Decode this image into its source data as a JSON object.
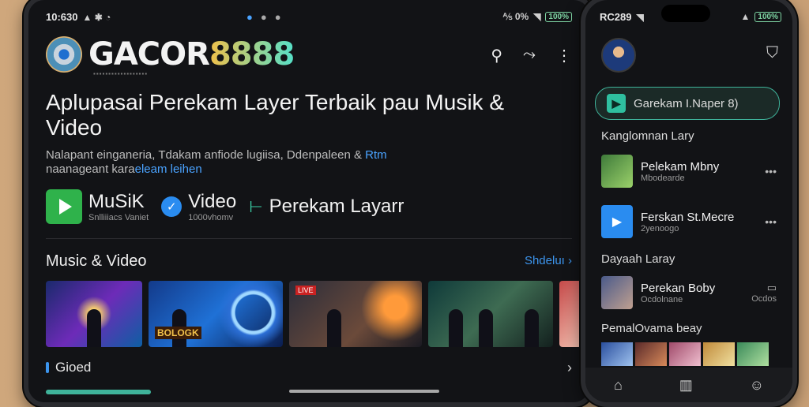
{
  "tablet": {
    "status": {
      "time": "10:630",
      "sys_icons": "▲ ✱ ◔",
      "right_text": "⅍ 0%",
      "battery": "100%"
    },
    "brand": {
      "part1": "GACOR",
      "part2": "8888",
      "subtitle": "▪▪▪▪▪▪▪▪▪▪▪▪▪▪▪▪▪▪"
    },
    "headline": "Aplupasai Perekam Layer Terbaik pau Musik & Video",
    "description_line1": "Nalapant einganeria, Tdakam anfiode lugiisa, Ddenpaleen  &",
    "description_highlight1": "Rtm",
    "description_line2_prefix": "naanageant kara",
    "description_highlight2": "eleam leihen",
    "categories": [
      {
        "label": "MuSiK",
        "sub": "Snlliiiacs Vaniet",
        "icon": "play-icon"
      },
      {
        "label": "Video",
        "sub": "1000vhomv",
        "icon": "check-icon"
      },
      {
        "label": "Perekam Layarr",
        "sub": "",
        "icon": "record-icon"
      }
    ],
    "section_title": "Music & Video",
    "section_link": "Shdeluı",
    "thumb_tags": {
      "t2": "BOLOGK",
      "t3": "LIVE"
    },
    "bottom_label": "Gioed",
    "progress": 0.19
  },
  "phone": {
    "status": {
      "time": "RC289",
      "battery": "100%"
    },
    "search_text": "Garekam I.Naper 8)",
    "section1": "Kanglomnan Lary",
    "items": [
      {
        "title": "Pelekam Mbny",
        "sub": "Mbodearde"
      },
      {
        "title": "Ferskan St.Mecre",
        "sub": "2yenoogo"
      }
    ],
    "section2": "Dayaah Laray",
    "item3": {
      "title": "Perekan Boby",
      "sub": "Ocdolnane",
      "right": "Ocdos"
    },
    "section3": "PemalOvama beay",
    "icons": {
      "bag": "bag-icon",
      "home": "home-icon",
      "library": "library-icon",
      "profile": "profile-icon"
    }
  },
  "colors": {
    "accent_teal": "#3fb39a",
    "link_blue": "#3c95ee",
    "play_green": "#2fb24b"
  }
}
